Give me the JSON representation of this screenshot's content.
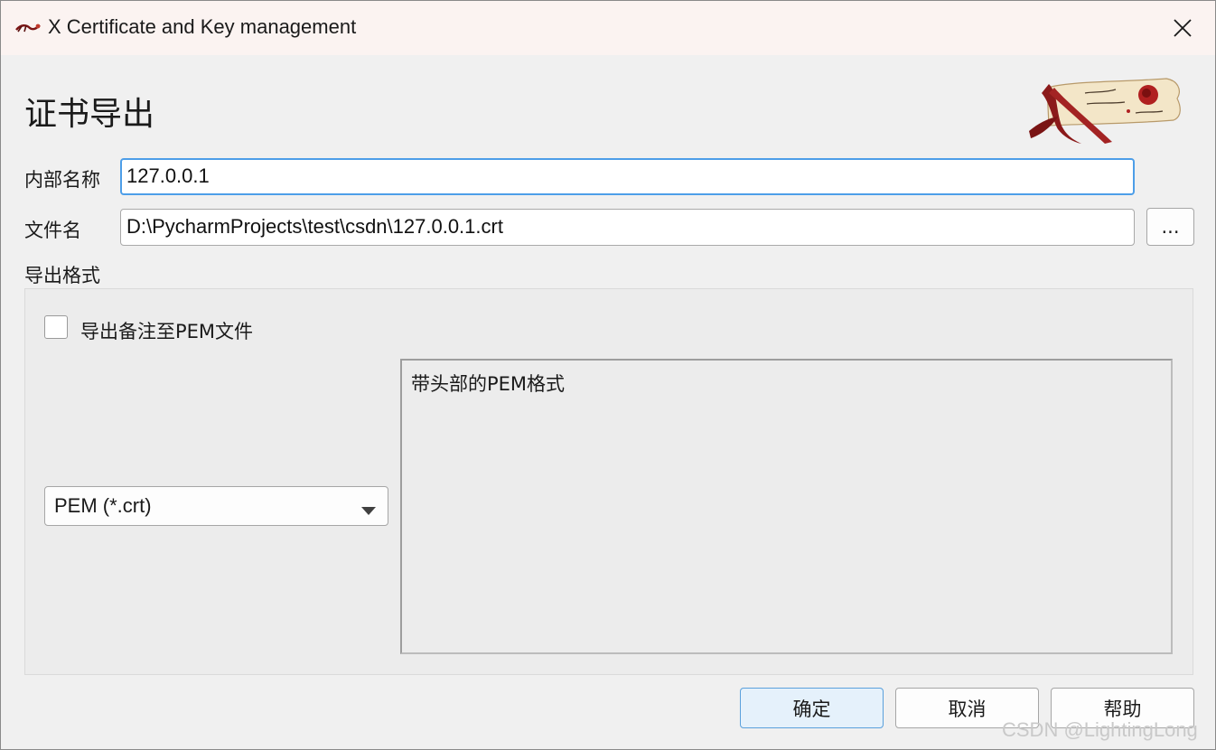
{
  "window": {
    "title": "X Certificate and Key management",
    "icons": {
      "app": "scroll-logo-icon",
      "close": "close-icon"
    }
  },
  "dialog": {
    "heading": "证书导出",
    "logo_icon": "scroll-quill-logo",
    "internal_name": {
      "label": "内部名称",
      "value": "127.0.0.1"
    },
    "filename": {
      "label": "文件名",
      "value": "D:\\PycharmProjects\\test\\csdn\\127.0.0.1.crt",
      "browse_label": "..."
    },
    "export_format": {
      "section_label": "导出格式",
      "pem_comment_checkbox": {
        "label": "导出备注至PEM文件",
        "checked": false
      },
      "format_select": {
        "selected": "PEM (*.crt)"
      },
      "description": "带头部的PEM格式"
    },
    "buttons": {
      "ok": "确定",
      "cancel": "取消",
      "help": "帮助"
    }
  },
  "watermark": "CSDN @LightingLong",
  "colors": {
    "titlebar_bg": "#fbf3f1",
    "window_bg": "#f0f0f0",
    "focus_border": "#4d9ee8",
    "default_button_bg": "#e5f1fb",
    "logo_red": "#8b1a1a",
    "logo_parchment": "#f3e6c8"
  }
}
